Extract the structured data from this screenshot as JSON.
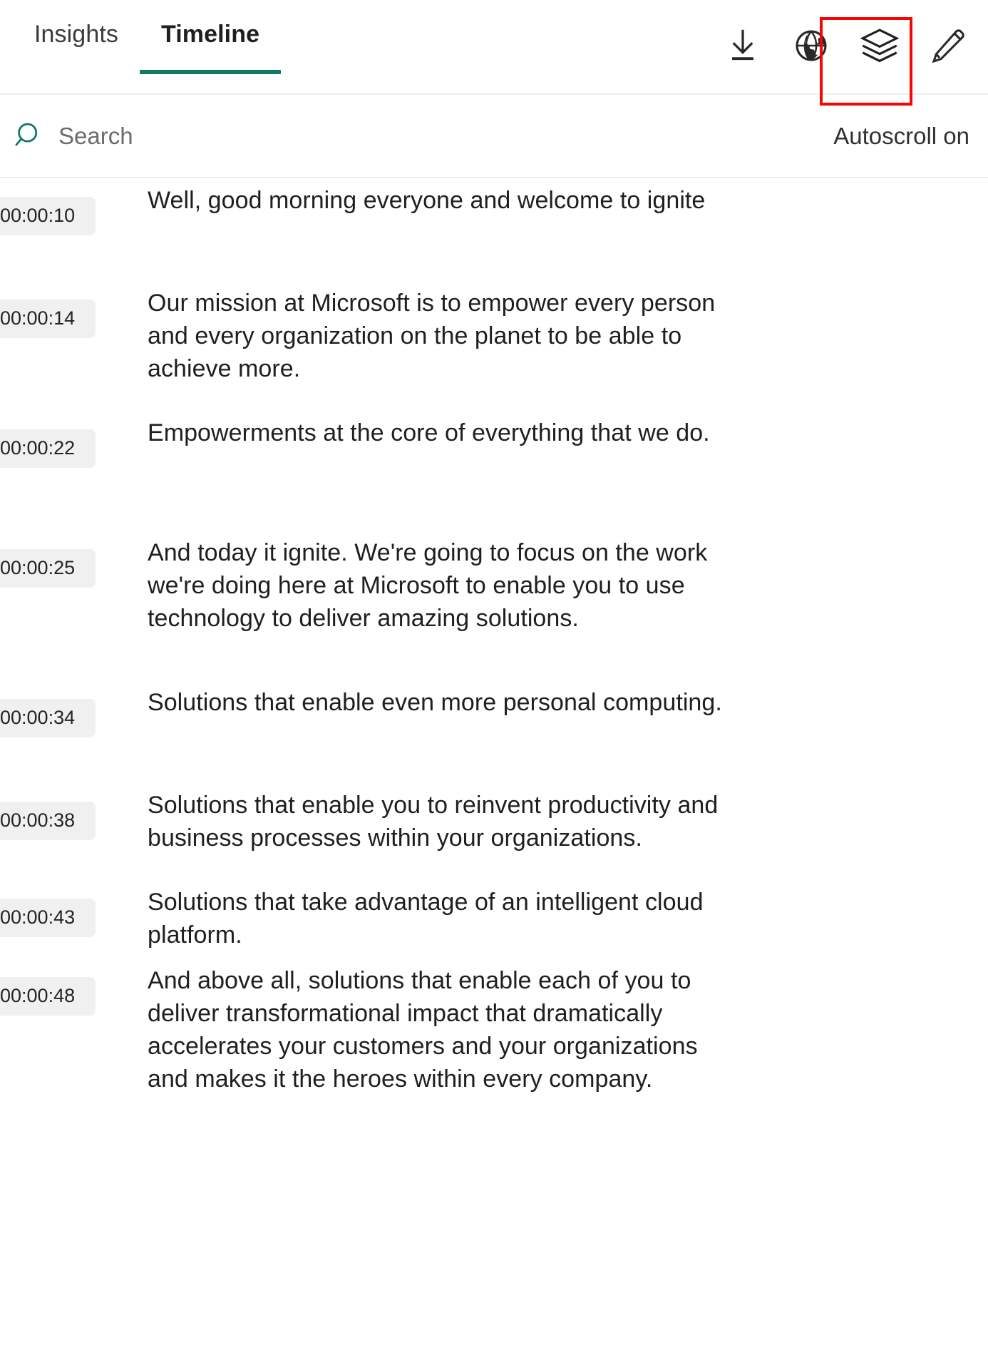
{
  "header": {
    "tabs": [
      {
        "label": "Insights",
        "active": false
      },
      {
        "label": "Timeline",
        "active": true
      }
    ],
    "toolbar": [
      {
        "name": "download-icon",
        "title": "Download"
      },
      {
        "name": "globe-icon",
        "title": "Translate"
      },
      {
        "name": "layers-icon",
        "title": "Layers"
      },
      {
        "name": "pencil-icon",
        "title": "Edit"
      }
    ],
    "accent_color": "#107865",
    "highlight_color": "#f90404"
  },
  "search": {
    "placeholder": "Search",
    "value": "",
    "icon": "search-icon",
    "autoscroll_label": "Autoscroll on"
  },
  "transcript": {
    "entries": [
      {
        "time": "00:00:10",
        "text": "Well, good morning everyone and welcome to ignite"
      },
      {
        "time": "00:00:14",
        "text": "Our mission at Microsoft is to empower every person and every organization on the planet to be able to achieve more."
      },
      {
        "time": "00:00:22",
        "text": "Empowerments at the core of everything that we do."
      },
      {
        "time": "00:00:25",
        "text": "And today it ignite. We're going to focus on the work we're doing here at Microsoft to enable you to use technology to deliver amazing solutions."
      },
      {
        "time": "00:00:34",
        "text": "Solutions that enable even more personal computing."
      },
      {
        "time": "00:00:38",
        "text": "Solutions that enable you to reinvent productivity and business processes within your organizations."
      },
      {
        "time": "00:00:43",
        "text": "Solutions that take advantage of an intelligent cloud platform."
      },
      {
        "time": "00:00:48",
        "text": "And above all, solutions that enable each of you to deliver transformational impact that dramatically accelerates your customers and your organizations and makes it the heroes within every company."
      }
    ]
  }
}
